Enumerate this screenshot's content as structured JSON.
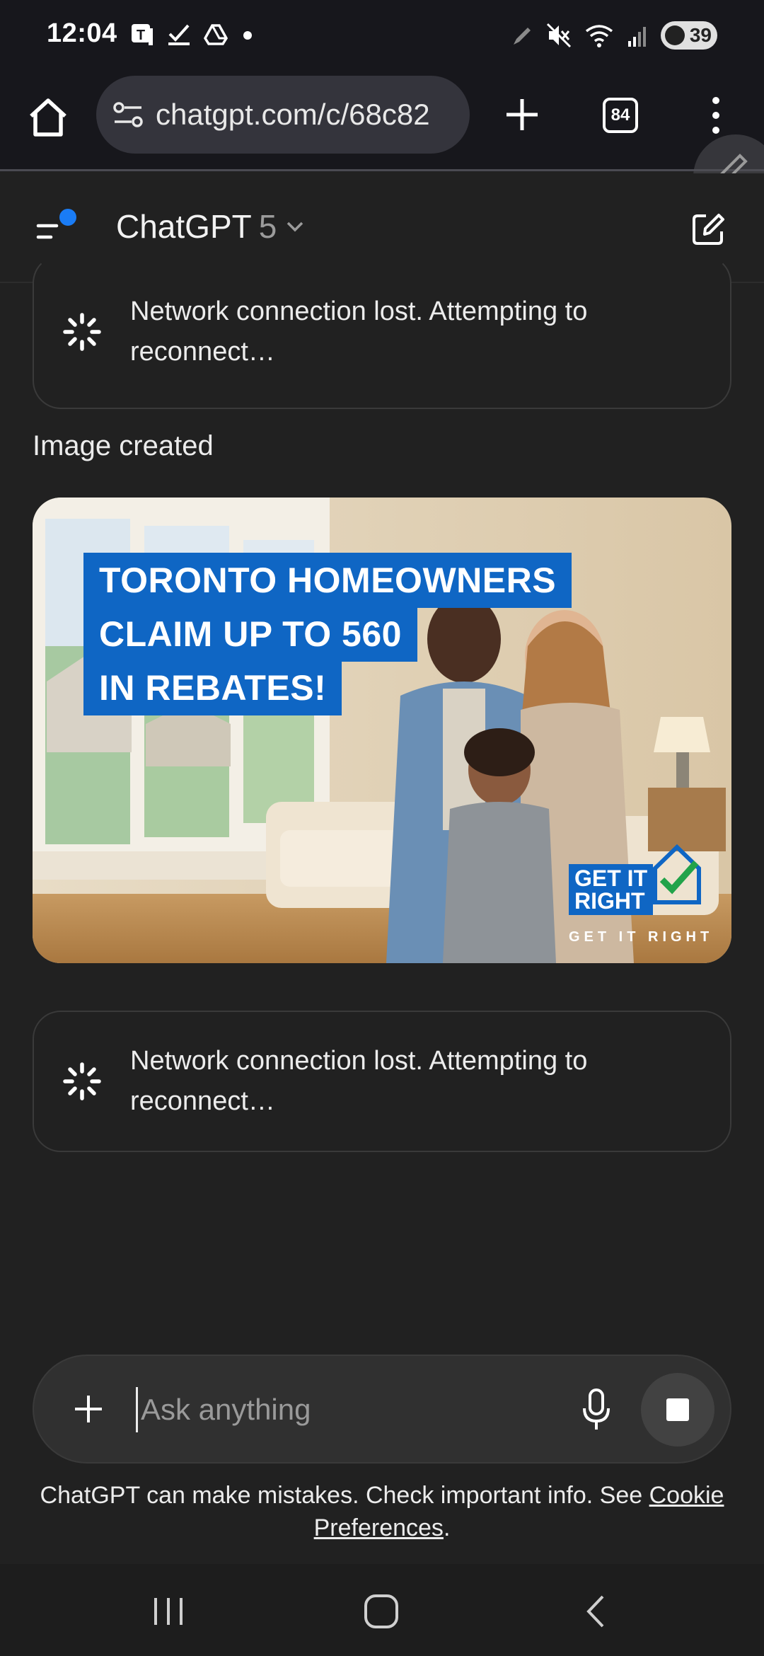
{
  "status_bar": {
    "time": "12:04",
    "battery": "39",
    "left_icons": [
      "t-app-icon",
      "check-icon",
      "drive-icon",
      "dot-icon"
    ],
    "right_icons": [
      "pen-icon",
      "mute-icon",
      "wifi-icon",
      "signal-icon"
    ]
  },
  "browser": {
    "url": "chatgpt.com/c/68c82",
    "tab_count": "84"
  },
  "header": {
    "model_name": "ChatGPT",
    "model_version": "5"
  },
  "messages": {
    "network_error_1": "Network connection lost. Attempting to reconnect…",
    "image_created_label": "Image created",
    "network_error_2": "Network connection lost. Attempting to reconnect…"
  },
  "image": {
    "headline_line1": "TORONTO HOMEOWNERS",
    "headline_line2": "CLAIM UP TO 560",
    "headline_line3": "IN REBATES!",
    "logo_line1": "GET IT",
    "logo_line2": "RIGHT",
    "logo_sub": "GET IT RIGHT"
  },
  "composer": {
    "placeholder": "Ask anything"
  },
  "disclaimer": {
    "text": "ChatGPT can make mistakes. Check important info. See ",
    "link": "Cookie Preferences",
    "end": "."
  },
  "colors": {
    "background": "#212121",
    "accent_blue": "#1a7cf5",
    "headline_blue": "#0f66c4"
  }
}
